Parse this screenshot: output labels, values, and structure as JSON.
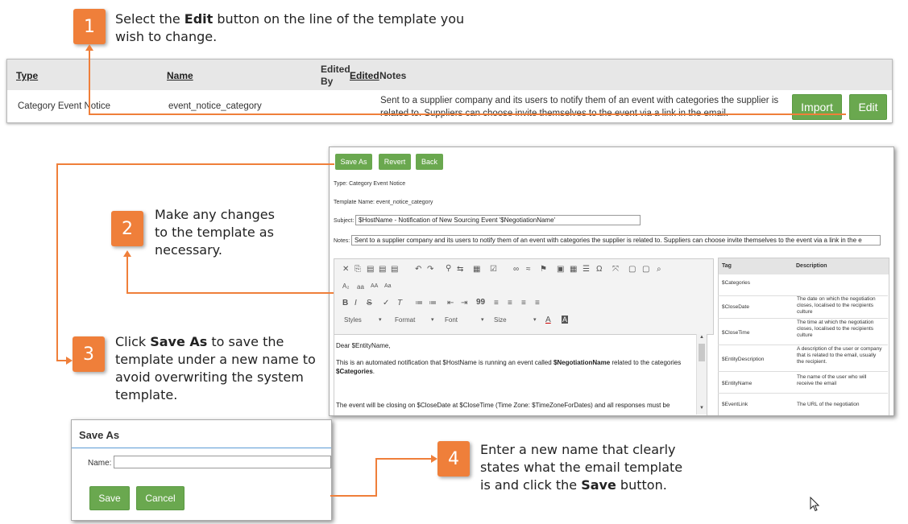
{
  "steps": [
    {
      "num": "1",
      "pre": "Select the ",
      "bold": "Edit",
      "post": " button on the line of the template you",
      "line2": "wish to change."
    },
    {
      "num": "2",
      "line1": "Make any changes",
      "line2": "to the template as",
      "line3": "necessary."
    },
    {
      "num": "3",
      "pre": "Click ",
      "bold": "Save As",
      "post": " to save the",
      "line2": "template under a new name to",
      "line3": "avoid overwriting the system",
      "line4": "template."
    },
    {
      "num": "4",
      "line1": "Enter a new name that clearly",
      "line2": "states what the email template",
      "pre3": "is and click the ",
      "bold3": "Save",
      "post3": " button."
    }
  ],
  "template_list": {
    "headers": {
      "type": "Type",
      "name": "Name",
      "edited_by_1": "Edited",
      "edited_by_2": "By",
      "edited": "Edited",
      "notes": "Notes"
    },
    "row": {
      "type": "Category Event Notice",
      "name": "event_notice_category",
      "notes_1": "Sent to a supplier company and its users to notify them of an event with categories the supplier is",
      "notes_2": "related to. Suppliers can choose invite themselves to the event via a link in the email."
    },
    "import_label": "Import",
    "edit_label": "Edit"
  },
  "editor": {
    "save_as_label": "Save As",
    "revert_label": "Revert",
    "back_label": "Back",
    "type_line": "Type: Category Event Notice",
    "template_name_line": "Template Name: event_notice_category",
    "subject_label": "Subject:",
    "subject_value": "$HostName - Notification of New Sourcing Event '$NegotiationName'",
    "notes_label": "Notes:",
    "notes_value": "Sent to a supplier company and its users to notify them of an event with categories the supplier is related to. Suppliers can choose invite themselves to the event via a link in the e",
    "toolbar": {
      "styles": "Styles",
      "format": "Format",
      "font": "Font",
      "size": "Size",
      "text_sizes": [
        "aa",
        "AA",
        "Aa"
      ]
    },
    "body": {
      "greeting": "Dear $EntityName,",
      "p1_pre": "This is an automated notification that $HostName is running an event called ",
      "p1_bold": "$NegotiationName",
      "p1_mid": " related to the categories ",
      "p1_bold2": "$Categories",
      "p1_end": ".",
      "p2": "The event will be closing on $CloseDate at $CloseTime (Time Zone: $TimeZoneForDates) and all responses must be"
    },
    "tags": {
      "tag_header": "Tag",
      "desc_header": "Description",
      "rows": [
        {
          "tag": "$Categories",
          "desc": ""
        },
        {
          "tag": "$CloseDate",
          "desc": "The date on which the negotiation closes, localised to the recipients culture"
        },
        {
          "tag": "$CloseTime",
          "desc": "The time at which the negotiation closes, localised to the recipients culture"
        },
        {
          "tag": "$EntityDescription",
          "desc": "A description of the user or company that is related to the email, usually the recipient."
        },
        {
          "tag": "$EntityName",
          "desc": "The name of the user who will receive the email"
        },
        {
          "tag": "$EventLink",
          "desc": "The URL of the negotiation"
        }
      ]
    }
  },
  "save_as_dialog": {
    "title": "Save As",
    "name_label": "Name:",
    "name_value": "",
    "save_label": "Save",
    "cancel_label": "Cancel"
  },
  "colors": {
    "accent_orange": "#ef7f3a",
    "button_green": "#6aa84f"
  }
}
